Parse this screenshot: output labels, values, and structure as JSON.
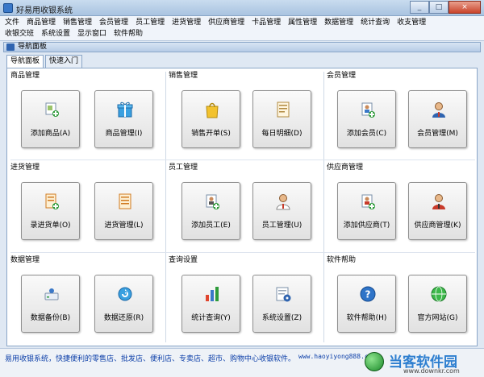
{
  "window": {
    "title": "好易用收银系统",
    "min": "_",
    "max": "□",
    "close": "×"
  },
  "menu": {
    "row1": [
      "文件",
      "商品管理",
      "销售管理",
      "会员管理",
      "员工管理",
      "进货管理",
      "供应商管理",
      "卡品管理",
      "属性管理",
      "数据管理",
      "统计查询",
      "收支管理"
    ],
    "row2": [
      "收银交班",
      "系统设置",
      "显示窗口",
      "软件帮助"
    ]
  },
  "panel": {
    "title": "导航面板"
  },
  "tabs": [
    "导航面板",
    "快速入门"
  ],
  "groups": [
    {
      "title": "商品管理",
      "buttons": [
        {
          "label": "添加商品(A)",
          "icon": "add-product-icon"
        },
        {
          "label": "商品管理(I)",
          "icon": "gift-icon"
        }
      ]
    },
    {
      "title": "销售管理",
      "buttons": [
        {
          "label": "销售开单(S)",
          "icon": "shopping-bag-icon"
        },
        {
          "label": "每日明细(D)",
          "icon": "receipt-icon"
        }
      ]
    },
    {
      "title": "会员管理",
      "buttons": [
        {
          "label": "添加会员(C)",
          "icon": "add-member-icon"
        },
        {
          "label": "会员管理(M)",
          "icon": "member-icon"
        }
      ]
    },
    {
      "title": "进货管理",
      "buttons": [
        {
          "label": "录进货单(O)",
          "icon": "add-purchase-icon"
        },
        {
          "label": "进货管理(L)",
          "icon": "purchase-list-icon"
        }
      ]
    },
    {
      "title": "员工管理",
      "buttons": [
        {
          "label": "添加员工(E)",
          "icon": "add-employee-icon"
        },
        {
          "label": "员工管理(U)",
          "icon": "employee-icon"
        }
      ]
    },
    {
      "title": "供应商管理",
      "buttons": [
        {
          "label": "添加供应商(T)",
          "icon": "add-supplier-icon"
        },
        {
          "label": "供应商管理(K)",
          "icon": "supplier-icon"
        }
      ]
    },
    {
      "title": "数据管理",
      "buttons": [
        {
          "label": "数据备份(B)",
          "icon": "backup-icon"
        },
        {
          "label": "数据还原(R)",
          "icon": "restore-icon"
        }
      ]
    },
    {
      "title": "查询设置",
      "buttons": [
        {
          "label": "统计查询(Y)",
          "icon": "bar-chart-icon"
        },
        {
          "label": "系统设置(Z)",
          "icon": "settings-icon"
        }
      ]
    },
    {
      "title": "软件帮助",
      "buttons": [
        {
          "label": "软件帮助(H)",
          "icon": "help-icon"
        },
        {
          "label": "官方网站(G)",
          "icon": "website-icon"
        }
      ]
    }
  ],
  "status": {
    "text": "易用收银系统，快捷便利的零售店、批发店、便利店、专卖店、超市、购物中心收银软件。",
    "url": "www.haoyiyong888.com"
  },
  "watermark": {
    "text": "当客软件园",
    "sub": "www.downkr.com"
  }
}
